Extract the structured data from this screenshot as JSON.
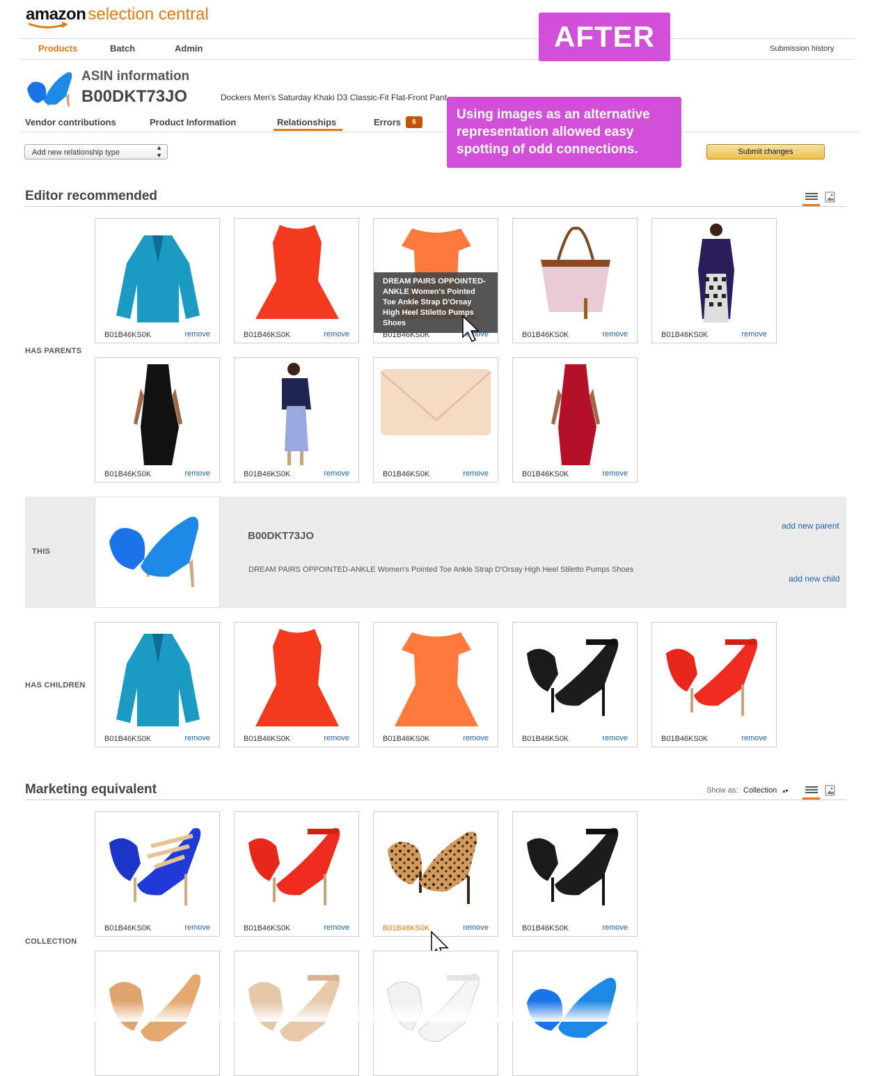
{
  "header": {
    "logo_amazon": "amazon",
    "logo_product": "selection central",
    "nav": [
      "Products",
      "Batch",
      "Admin"
    ],
    "submission_history": "Submission history"
  },
  "overlays": {
    "after_badge": "AFTER",
    "callout": "Using images as an alternative representation allowed easy spotting of odd connections."
  },
  "asin_info": {
    "heading": "ASIN information",
    "asin": "B00DKT73JO",
    "title": "Dockers Men's Saturday Khaki D3 Classic-Fit Flat-Front Pant"
  },
  "tabs": {
    "items": [
      "Vendor contributions",
      "Product Information",
      "Relationships",
      "Errors"
    ],
    "active": "Relationships",
    "errors_count": "6"
  },
  "toolbar": {
    "relationship_select": "Add new relationship type",
    "submit": "Submit changes"
  },
  "editor_recommended": {
    "title": "Editor recommended",
    "parents_label": "HAS PARENTS",
    "this_label": "THIS",
    "children_label": "HAS CHILDREN",
    "item_asin": "B01B46KS0K",
    "remove": "remove",
    "tooltip": "DREAM PAIRS OPPOINTED-ANKLE Women's Pointed Toe Ankle Strap D'Orsay High Heel Stiletto Pumps Shoes",
    "this_item": {
      "asin": "B00DKT73JO",
      "title": "DREAM PAIRS OPPOINTED-ANKLE Women's Pointed Toe Ankle Strap D'Orsay High Heel Stiletto Pumps Shoes",
      "add_parent": "add new parent",
      "add_child": "add new child"
    }
  },
  "marketing_equivalent": {
    "title": "Marketing equivalent",
    "show_as_label": "Show as:",
    "show_as_value": "Collection",
    "row_label": "COLLECTION"
  },
  "colors": {
    "accent": "#e47911",
    "callout": "#d24fd8",
    "link": "#1d5fa8",
    "submit": "#f0c14b"
  }
}
